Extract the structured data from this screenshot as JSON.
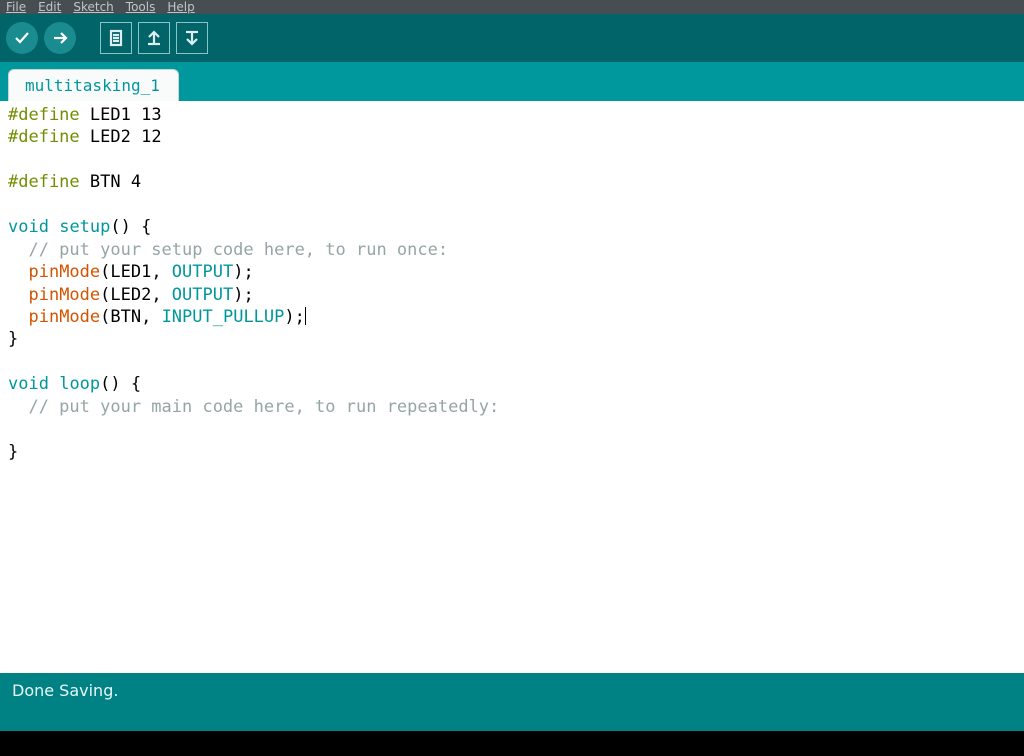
{
  "menubar": {
    "file": "File",
    "edit": "Edit",
    "sketch": "Sketch",
    "tools": "Tools",
    "help": "Help"
  },
  "tab": {
    "name": "multitasking_1"
  },
  "code": {
    "define_kw": "#define",
    "def_led1": "LED1 13",
    "def_led2": "LED2 12",
    "def_btn": "BTN 4",
    "void_kw": "void",
    "setup_kw": "setup",
    "loop_kw": "loop",
    "paren_open": "() {",
    "close_brace": "}",
    "cmt_setup": "  // put your setup code here, to run once:",
    "cmt_loop": "  // put your main code here, to run repeatedly:",
    "pinmode_fn": "pinMode",
    "pm_led1_a": "(LED1, ",
    "pm_led2_a": "(LED2, ",
    "pm_btn_a": "(BTN, ",
    "output_const": "OUTPUT",
    "input_pullup_const": "INPUT_PULLUP",
    "close_paren_semi": ");"
  },
  "status": {
    "text": "Done Saving."
  },
  "colors": {
    "teal_dark": "#006468",
    "teal": "#00979d",
    "status_teal": "#008184",
    "keyword": "#00979c",
    "function": "#d35400",
    "define": "#728e00",
    "comment": "#95a5a6"
  }
}
